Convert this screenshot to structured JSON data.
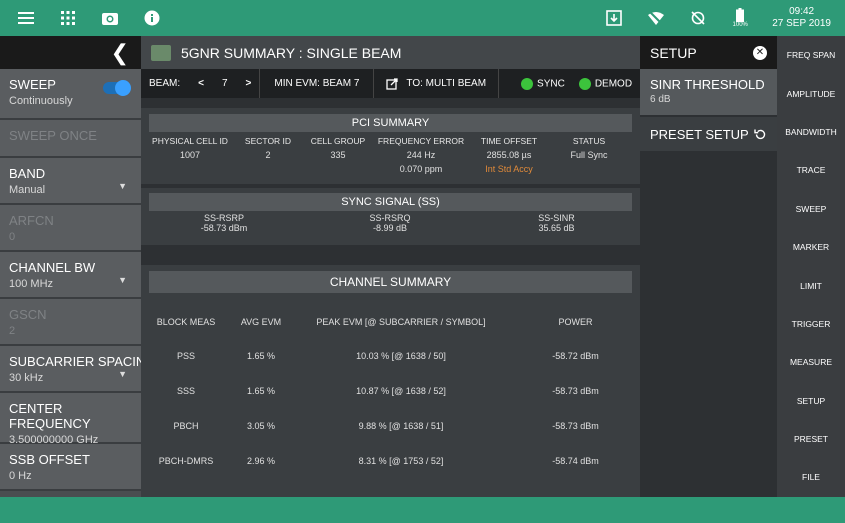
{
  "status_bar": {
    "left_icons": [
      "menu-icon",
      "apps-grid-icon",
      "camera-icon",
      "info-icon"
    ],
    "right_icons": [
      "download-icon",
      "wifi-off-icon",
      "sync-off-icon",
      "battery-icon"
    ],
    "battery": "100%",
    "time": "09:42",
    "date": "27 SEP 2019"
  },
  "left_panel": {
    "items": [
      {
        "title": "SWEEP",
        "value": "Continuously",
        "toggle": true
      },
      {
        "title": "SWEEP ONCE",
        "value": "",
        "disabled": true
      },
      {
        "title": "BAND",
        "value": "Manual",
        "dropdown": true
      },
      {
        "title": "ARFCN",
        "value": "0",
        "disabled": true
      },
      {
        "title": "CHANNEL BW",
        "value": "100 MHz",
        "dropdown": true
      },
      {
        "title": "GSCN",
        "value": "2",
        "disabled": true
      },
      {
        "title": "SUBCARRIER SPACING",
        "value": "30 kHz",
        "dropdown": true
      },
      {
        "title": "CENTER FREQUENCY",
        "value": "3.500000000 GHz"
      },
      {
        "title": "SSB OFFSET",
        "value": "0 Hz"
      }
    ]
  },
  "main": {
    "title": "5GNR SUMMARY : SINGLE BEAM",
    "beam": {
      "label": "BEAM:",
      "value": "7",
      "prev": "<",
      "next": ">"
    },
    "min_evm": "MIN EVM: BEAM 7",
    "to_multi": "TO: MULTI BEAM",
    "sync": "SYNC",
    "demod": "DEMOD",
    "pci": {
      "heading": "PCI SUMMARY",
      "headers": [
        "PHYSICAL CELL ID",
        "SECTOR ID",
        "CELL GROUP",
        "FREQUENCY ERROR",
        "TIME OFFSET",
        "STATUS"
      ],
      "values": [
        "1007",
        "2",
        "335",
        "244 Hz",
        "2855.08 µs",
        "Full Sync"
      ],
      "sub": [
        "",
        "",
        "",
        "0.070 ppm",
        "Int Std Accy",
        ""
      ]
    },
    "sync_signal": {
      "heading": "SYNC SIGNAL (SS)",
      "headers": [
        "SS-RSRP",
        "SS-RSRQ",
        "SS-SINR"
      ],
      "values": [
        "-58.73 dBm",
        "-8.99 dB",
        "35.65 dB"
      ]
    },
    "channel": {
      "heading": "CHANNEL SUMMARY",
      "headers": [
        "BLOCK MEAS",
        "AVG EVM",
        "PEAK EVM [@ SUBCARRIER / SYMBOL]",
        "POWER"
      ],
      "rows": [
        [
          "PSS",
          "1.65 %",
          "10.03 % [@ 1638 / 50]",
          "-58.72 dBm"
        ],
        [
          "SSS",
          "1.65 %",
          "10.87 % [@ 1638 / 52]",
          "-58.73 dBm"
        ],
        [
          "PBCH",
          "3.05 %",
          "9.88 % [@ 1638 / 51]",
          "-58.73 dBm"
        ],
        [
          "PBCH-DMRS",
          "2.96 %",
          "8.31 % [@ 1753 / 52]",
          "-58.74 dBm"
        ]
      ]
    }
  },
  "setup_panel": {
    "title": "SETUP",
    "items": [
      {
        "title": "SINR THRESHOLD",
        "value": "6 dB"
      },
      {
        "title": "PRESET SETUP",
        "value": ""
      }
    ]
  },
  "right_rail": [
    "FREQ SPAN",
    "AMPLITUDE",
    "BANDWIDTH",
    "TRACE",
    "SWEEP",
    "MARKER",
    "LIMIT",
    "TRIGGER",
    "MEASURE",
    "SETUP",
    "PRESET",
    "FILE"
  ]
}
